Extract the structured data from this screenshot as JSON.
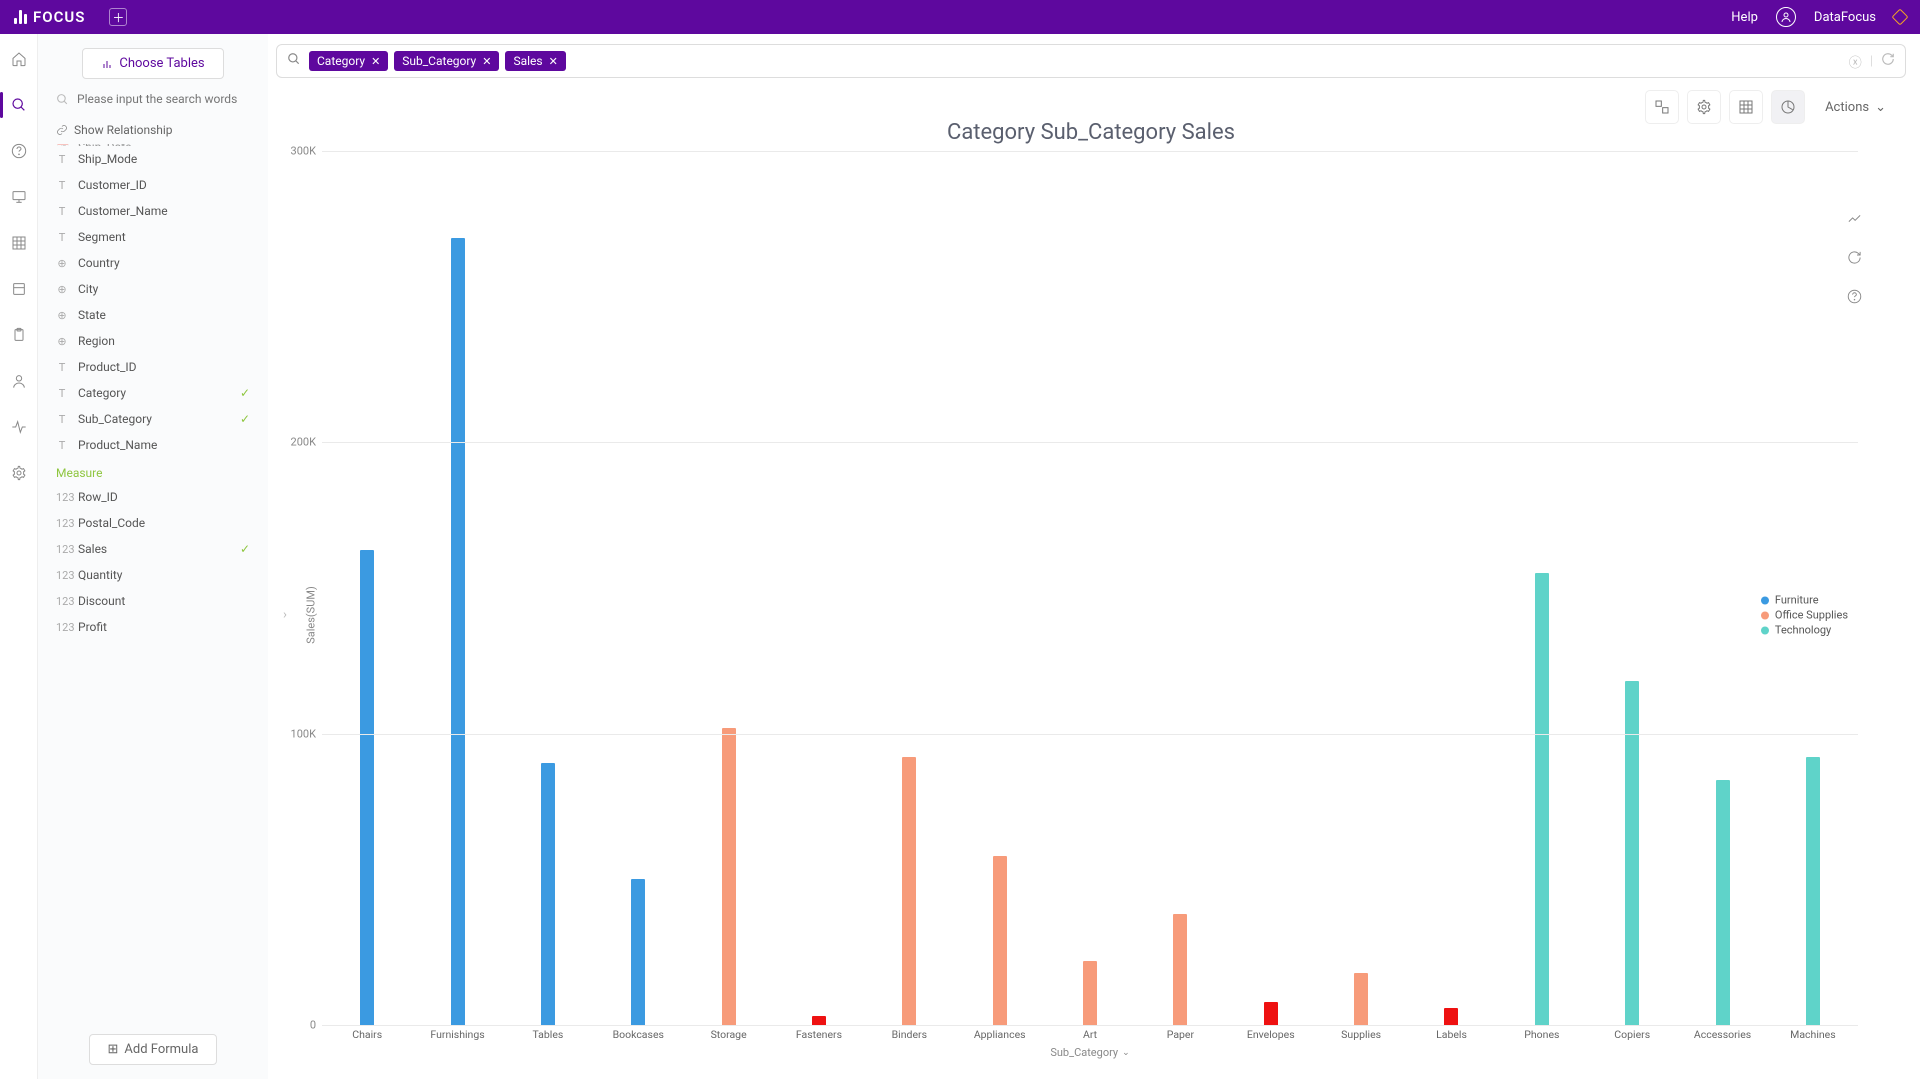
{
  "header": {
    "app_name": "FOCUS",
    "help_label": "Help",
    "user_name": "DataFocus"
  },
  "sidebar": {
    "choose_tables_label": "Choose Tables",
    "search_placeholder": "Please input the search words",
    "relationship_label": "Show Relationship",
    "measure_label": "Measure",
    "add_formula_label": "Add Formula",
    "fields": [
      {
        "icon": "cal",
        "label": "Ship_Date",
        "checked": false,
        "cut": true
      },
      {
        "icon": "T",
        "label": "Ship_Mode",
        "checked": false
      },
      {
        "icon": "T",
        "label": "Customer_ID",
        "checked": false
      },
      {
        "icon": "T",
        "label": "Customer_Name",
        "checked": false
      },
      {
        "icon": "T",
        "label": "Segment",
        "checked": false
      },
      {
        "icon": "geo",
        "label": "Country",
        "checked": false
      },
      {
        "icon": "geo",
        "label": "City",
        "checked": false
      },
      {
        "icon": "geo",
        "label": "State",
        "checked": false
      },
      {
        "icon": "geo",
        "label": "Region",
        "checked": false
      },
      {
        "icon": "T",
        "label": "Product_ID",
        "checked": false
      },
      {
        "icon": "T",
        "label": "Category",
        "checked": true
      },
      {
        "icon": "T",
        "label": "Sub_Category",
        "checked": true
      },
      {
        "icon": "T",
        "label": "Product_Name",
        "checked": false
      }
    ],
    "measures": [
      {
        "icon": "123",
        "label": "Row_ID",
        "checked": false
      },
      {
        "icon": "123",
        "label": "Postal_Code",
        "checked": false
      },
      {
        "icon": "123",
        "label": "Sales",
        "checked": true
      },
      {
        "icon": "123",
        "label": "Quantity",
        "checked": false
      },
      {
        "icon": "123",
        "label": "Discount",
        "checked": false
      },
      {
        "icon": "123",
        "label": "Profit",
        "checked": false
      }
    ]
  },
  "query": {
    "chips": [
      "Category",
      "Sub_Category",
      "Sales"
    ]
  },
  "toolbar": {
    "actions_label": "Actions"
  },
  "chart_data": {
    "type": "bar",
    "title": "Category Sub_Category Sales",
    "ylabel": "Sales(SUM)",
    "xlabel": "Sub_Category",
    "ylim": [
      0,
      300000
    ],
    "yticks": [
      {
        "v": 0,
        "l": "0"
      },
      {
        "v": 100000,
        "l": "100K"
      },
      {
        "v": 200000,
        "l": "200K"
      },
      {
        "v": 300000,
        "l": "300K"
      }
    ],
    "colors": {
      "Furniture": "#3b9ae1",
      "Office Supplies": "#f79b7a",
      "Technology": "#5fd3c9",
      "Highlight": "#e11"
    },
    "legend": [
      "Furniture",
      "Office Supplies",
      "Technology"
    ],
    "data": [
      {
        "sub": "Chairs",
        "cat": "Furniture",
        "value": 163000
      },
      {
        "sub": "Furnishings",
        "cat": "Furniture",
        "value": 270000
      },
      {
        "sub": "Tables",
        "cat": "Furniture",
        "value": 90000
      },
      {
        "sub": "Bookcases",
        "cat": "Furniture",
        "value": 50000
      },
      {
        "sub": "Storage",
        "cat": "Office Supplies",
        "value": 102000
      },
      {
        "sub": "Fasteners",
        "cat": "Highlight",
        "value": 3000
      },
      {
        "sub": "Binders",
        "cat": "Office Supplies",
        "value": 92000
      },
      {
        "sub": "Appliances",
        "cat": "Office Supplies",
        "value": 58000
      },
      {
        "sub": "Art",
        "cat": "Office Supplies",
        "value": 22000
      },
      {
        "sub": "Paper",
        "cat": "Office Supplies",
        "value": 38000
      },
      {
        "sub": "Envelopes",
        "cat": "Highlight",
        "value": 8000
      },
      {
        "sub": "Supplies",
        "cat": "Office Supplies",
        "value": 18000
      },
      {
        "sub": "Labels",
        "cat": "Highlight",
        "value": 6000
      },
      {
        "sub": "Phones",
        "cat": "Technology",
        "value": 155000
      },
      {
        "sub": "Copiers",
        "cat": "Technology",
        "value": 118000
      },
      {
        "sub": "Accessories",
        "cat": "Technology",
        "value": 84000
      },
      {
        "sub": "Machines",
        "cat": "Technology",
        "value": 92000
      }
    ]
  }
}
